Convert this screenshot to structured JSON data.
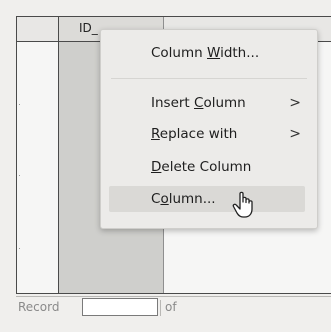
{
  "grid": {
    "column_header": "ID_"
  },
  "context_menu": {
    "items": [
      {
        "label": "Column Width...",
        "pre": "Column ",
        "key": "W",
        "post": "idth...",
        "submenu": false
      },
      {
        "label": "Insert Column",
        "pre": "Insert ",
        "key": "C",
        "post": "olumn",
        "submenu": true
      },
      {
        "label": "Replace with",
        "pre": "",
        "key": "R",
        "post": "eplace with",
        "submenu": true
      },
      {
        "label": "Delete Column",
        "pre": "",
        "key": "D",
        "post": "elete Column",
        "submenu": false
      },
      {
        "label": "Column...",
        "pre": "C",
        "key": "o",
        "post": "lumn...",
        "submenu": false,
        "hovered": true
      }
    ],
    "submenu_arrow": ">"
  },
  "record_nav": {
    "record_label": "Record",
    "record_value": "",
    "of_label": "of"
  }
}
